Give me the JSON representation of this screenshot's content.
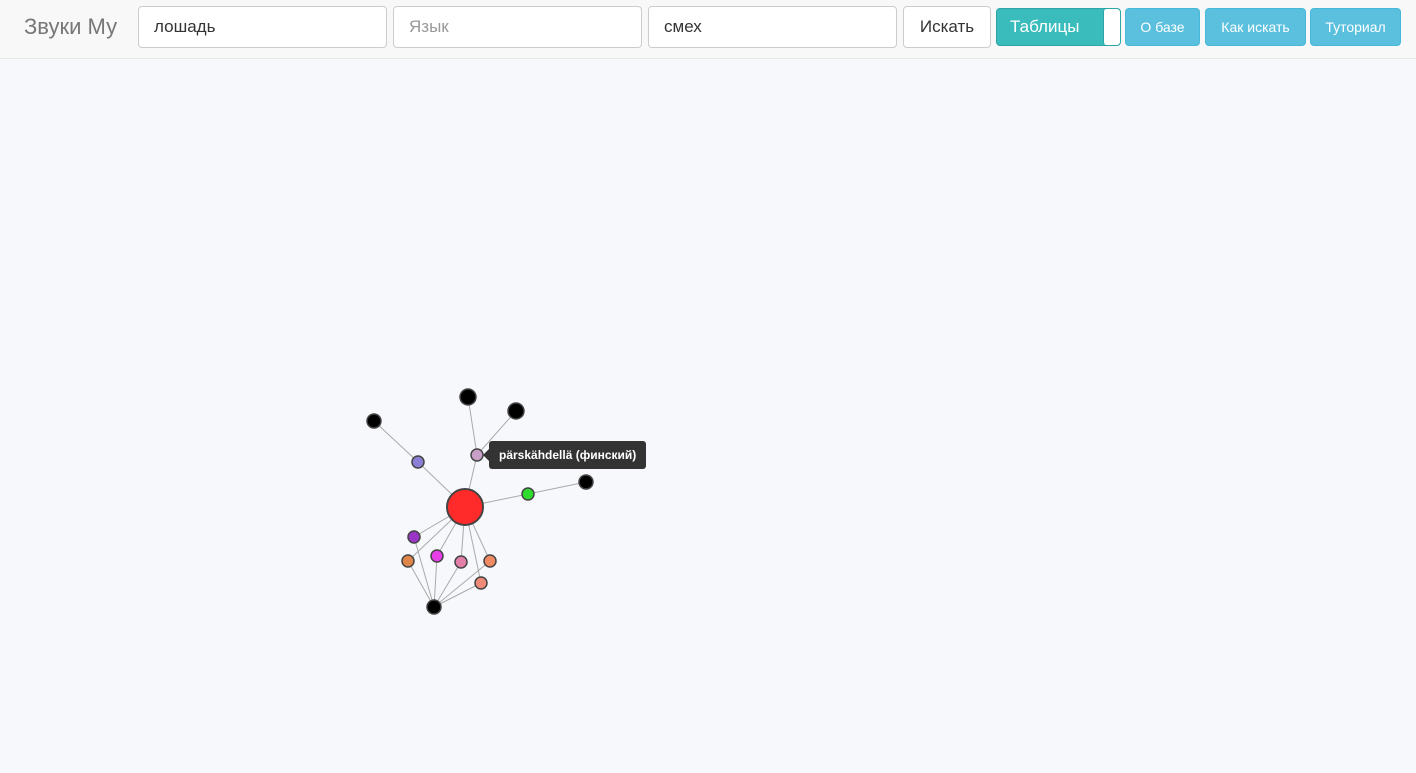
{
  "navbar": {
    "brand": "Звуки Му",
    "word_input": {
      "value": "лошадь",
      "placeholder": ""
    },
    "language_input": {
      "value": "",
      "placeholder": "Язык"
    },
    "meaning_input": {
      "value": "смех",
      "placeholder": ""
    },
    "search_label": "Искать",
    "tables_toggle_label": "Таблицы",
    "about_label": "О базе",
    "howto_label": "Как искать",
    "tutorial_label": "Туториал"
  },
  "tooltip": {
    "text": "pärskähdellä (финский)"
  },
  "graph": {
    "edge_color": "#aaaaaa",
    "node_stroke": "#444444",
    "center": {
      "id": "c",
      "color": "#ff2a2a"
    },
    "nodes": [
      {
        "id": "n1",
        "color": "#000000"
      },
      {
        "id": "n2",
        "color": "#8b7fd6"
      },
      {
        "id": "n3",
        "color": "#000000"
      },
      {
        "id": "n4",
        "color": "#000000"
      },
      {
        "id": "n5",
        "color": "#c8a0c8"
      },
      {
        "id": "n6",
        "color": "#2edc2e"
      },
      {
        "id": "n7",
        "color": "#000000"
      },
      {
        "id": "n8",
        "color": "#9a35c7"
      },
      {
        "id": "n9",
        "color": "#e0854a"
      },
      {
        "id": "n10",
        "color": "#e83ee8"
      },
      {
        "id": "n11",
        "color": "#e37ea8"
      },
      {
        "id": "n12",
        "color": "#ef8a62"
      },
      {
        "id": "n13",
        "color": "#ef8a78"
      },
      {
        "id": "n14",
        "color": "#000000"
      }
    ],
    "edges": [
      [
        "c",
        "n2"
      ],
      [
        "n2",
        "n1"
      ],
      [
        "c",
        "n5"
      ],
      [
        "n5",
        "n3"
      ],
      [
        "n5",
        "n4"
      ],
      [
        "c",
        "n6"
      ],
      [
        "n6",
        "n7"
      ],
      [
        "c",
        "n8"
      ],
      [
        "c",
        "n9"
      ],
      [
        "c",
        "n10"
      ],
      [
        "c",
        "n11"
      ],
      [
        "c",
        "n12"
      ],
      [
        "c",
        "n13"
      ],
      [
        "n8",
        "n14"
      ],
      [
        "n9",
        "n14"
      ],
      [
        "n10",
        "n14"
      ],
      [
        "n11",
        "n14"
      ],
      [
        "n12",
        "n14"
      ],
      [
        "n13",
        "n14"
      ]
    ]
  }
}
